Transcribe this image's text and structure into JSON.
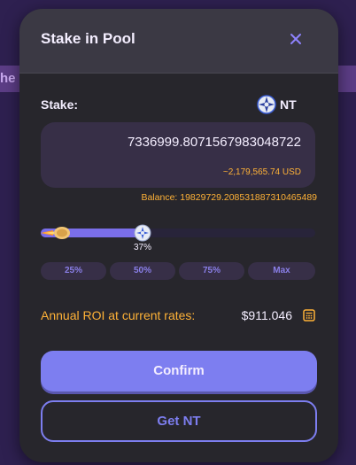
{
  "backdrop": {
    "partial_text": "he"
  },
  "modal": {
    "title": "Stake in Pool",
    "close_icon": "close-icon"
  },
  "stake": {
    "label": "Stake:",
    "token_icon": "nt-token-icon",
    "token_symbol": "NT",
    "amount": "7336999.8071567983048722",
    "usd_value": "~2,179,565.74 USD",
    "balance": "Balance: 19829729.208531887310465489"
  },
  "slider": {
    "percent": 37,
    "percent_label": "37%",
    "start_icon": "rocket-icon",
    "thumb_icon": "pancake-thumb-icon"
  },
  "percent_buttons": [
    "25%",
    "50%",
    "75%",
    "Max"
  ],
  "roi": {
    "label": "Annual ROI at current rates:",
    "value": "$911.046",
    "icon": "calculator-icon"
  },
  "buttons": {
    "confirm": "Confirm",
    "get_token": "Get NT"
  },
  "colors": {
    "accent": "#7d7ef0",
    "warning_text": "#ffb237",
    "modal_bg": "#27262c",
    "header_bg": "#3b3944",
    "input_bg": "#372f47"
  }
}
